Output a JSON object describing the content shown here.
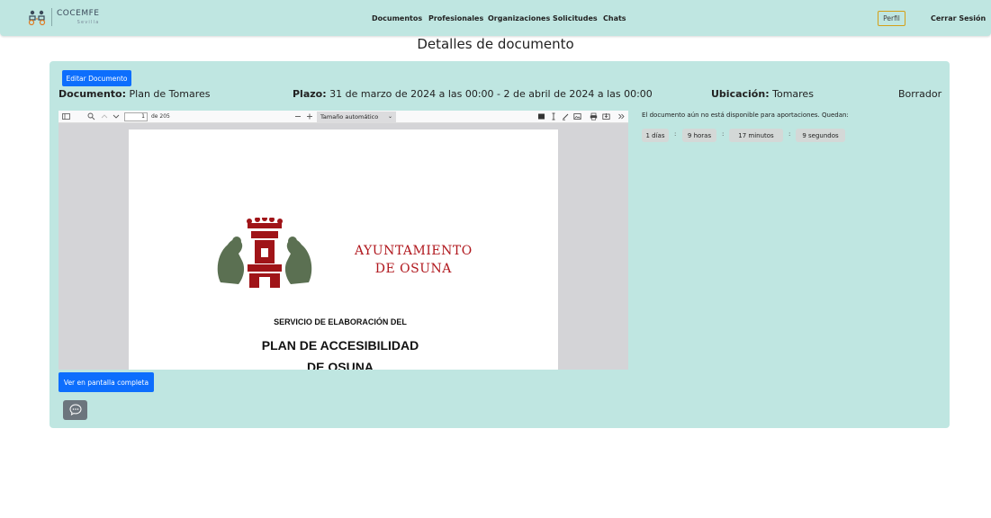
{
  "brand": {
    "name": "COCEMFE",
    "subtitle": "Sevilla"
  },
  "nav": {
    "links": [
      "Documentos",
      "Profesionales",
      "Organizaciones",
      "Solicitudes",
      "Chats"
    ],
    "profile": "Perfil",
    "logout": "Cerrar Sesión"
  },
  "page": {
    "title": "Detalles de documento"
  },
  "document": {
    "edit_button": "Editar Documento",
    "name_label": "Documento:",
    "name_value": "Plan de Tomares",
    "deadline_label": "Plazo:",
    "deadline_value": "31 de marzo de 2024 a las 00:00 - 2 de abril de 2024 a las 00:00",
    "location_label": "Ubicación:",
    "location_value": "Tomares",
    "status": "Borrador"
  },
  "viewer": {
    "page_number": "1",
    "page_count": "de 205",
    "zoom": "Tamaño automático",
    "pdf": {
      "council_line1": "AYUNTAMIENTO",
      "council_line2": "DE OSUNA",
      "service_line": "SERVICIO DE ELABORACIÓN DEL",
      "title_line1": "PLAN DE ACCESIBILIDAD",
      "title_line2": "DE OSUNA"
    }
  },
  "availability": {
    "notice": "El documento aún no está disponible para aportaciones. Quedan:",
    "days": "1 días",
    "hours": "9 horas",
    "minutes": "17 minutos",
    "seconds": "9 segundos",
    "separator": ":"
  },
  "actions": {
    "fullscreen": "Ver en pantalla completa"
  },
  "colors": {
    "navbar_bg": "#bfe6e1",
    "card_bg": "#bfe6e1",
    "primary": "#0d6efd",
    "profile_border": "#d4a017",
    "chat_button": "#6c757d",
    "council_red": "#b0171d"
  },
  "icons": [
    "sidebar-toggle-icon",
    "search-icon",
    "chevron-up-icon",
    "chevron-down-icon",
    "zoom-out-icon",
    "zoom-in-icon",
    "highlight-icon",
    "text-cursor-icon",
    "draw-icon",
    "image-icon",
    "print-icon",
    "save-icon",
    "more-tools-icon",
    "chat-bubble-icon"
  ]
}
